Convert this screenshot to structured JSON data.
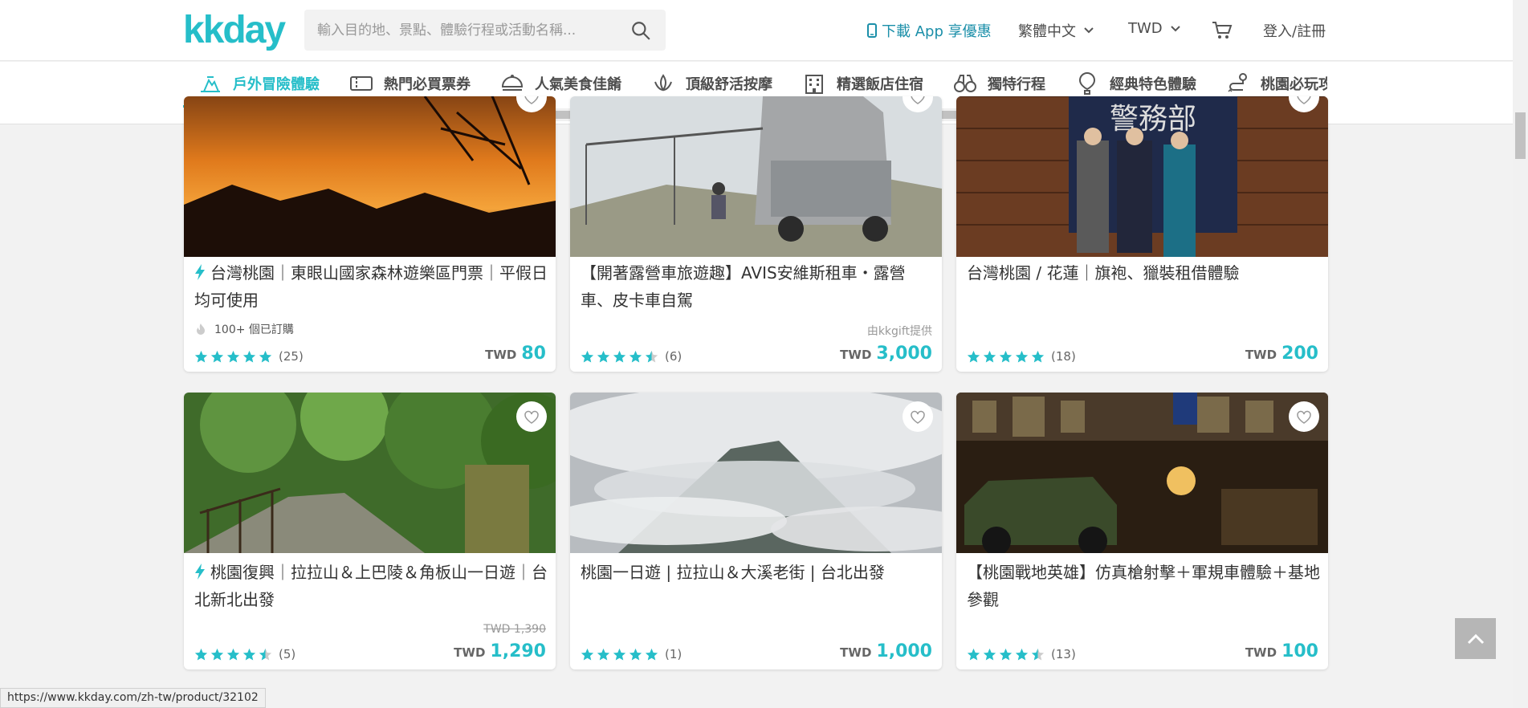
{
  "header": {
    "logo": "kkday",
    "search_placeholder": "輸入目的地、景點、體驗行程或活動名稱...",
    "app_link": "下載 App 享優惠",
    "language": "繁體中文",
    "currency": "TWD",
    "login": "登入/註冊"
  },
  "categories": [
    {
      "label": "戶外冒險體驗",
      "icon": "outdoor-icon",
      "active": true
    },
    {
      "label": "熱門必買票券",
      "icon": "ticket-icon"
    },
    {
      "label": "人氣美食佳餚",
      "icon": "food-icon"
    },
    {
      "label": "頂級舒活按摩",
      "icon": "spa-icon"
    },
    {
      "label": "精選飯店住宿",
      "icon": "hotel-icon"
    },
    {
      "label": "獨特行程",
      "icon": "binoculars-icon"
    },
    {
      "label": "經典特色體驗",
      "icon": "balloon-icon"
    },
    {
      "label": "桃園必玩攻略",
      "icon": "route-icon"
    }
  ],
  "products": [
    {
      "title": "台灣桃園｜東眼山國家森林遊樂區門票｜平假日均可使用",
      "instant": true,
      "booked": "100+ 個已訂購",
      "rating": 5,
      "reviews": "(25)",
      "currency": "TWD",
      "price": "80"
    },
    {
      "title": "【開著露營車旅遊趣】AVIS安維斯租車・露營車、皮卡車自駕",
      "provider": "由kkgift提供",
      "rating": 4.5,
      "reviews": "(6)",
      "currency": "TWD",
      "price": "3,000"
    },
    {
      "title": "台灣桃園 / 花蓮｜旗袍、獵裝租借體驗",
      "rating": 5,
      "reviews": "(18)",
      "currency": "TWD",
      "price": "200"
    },
    {
      "title": "桃園復興｜拉拉山＆上巴陵＆角板山一日遊｜台北新北出發",
      "instant": true,
      "original_price": "TWD 1,390",
      "rating": 4.5,
      "reviews": "(5)",
      "currency": "TWD",
      "price": "1,290"
    },
    {
      "title": "桃園一日遊 | 拉拉山＆大溪老街 | 台北出發",
      "rating": 5,
      "reviews": "(1)",
      "currency": "TWD",
      "price": "1,000"
    },
    {
      "title": "【桃園戰地英雄】仿真槍射擊＋軍規車體驗＋基地參觀",
      "rating": 4.5,
      "reviews": "(13)",
      "currency": "TWD",
      "price": "100"
    }
  ],
  "status_url": "https://www.kkday.com/zh-tw/product/32102",
  "colors": {
    "accent": "#26bec9",
    "star": "#26bec9"
  }
}
